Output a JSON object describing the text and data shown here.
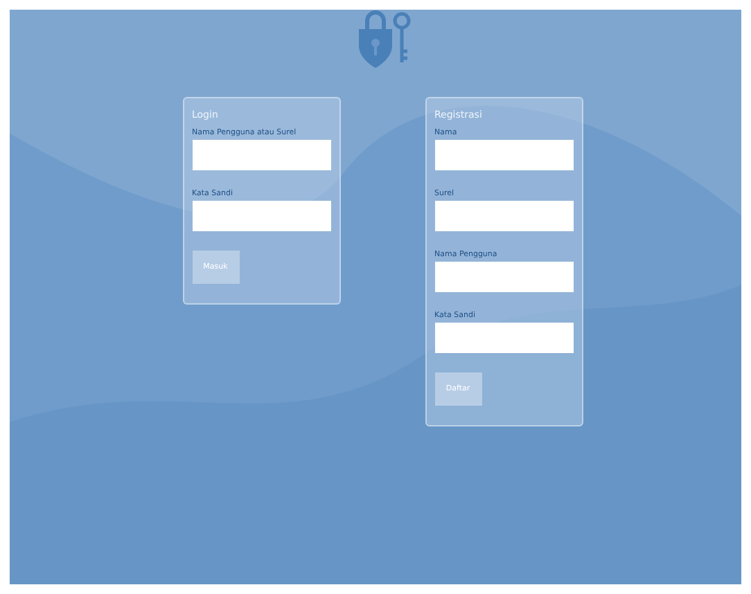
{
  "login": {
    "title": "Login",
    "fields": [
      {
        "label": "Nama Pengguna atau Surel"
      },
      {
        "label": "Kata Sandi"
      }
    ],
    "button": "Masuk"
  },
  "register": {
    "title": "Registrasi",
    "fields": [
      {
        "label": "Nama"
      },
      {
        "label": "Surel"
      },
      {
        "label": "Nama Pengguna"
      },
      {
        "label": "Kata Sandi"
      }
    ],
    "button": "Daftar"
  }
}
